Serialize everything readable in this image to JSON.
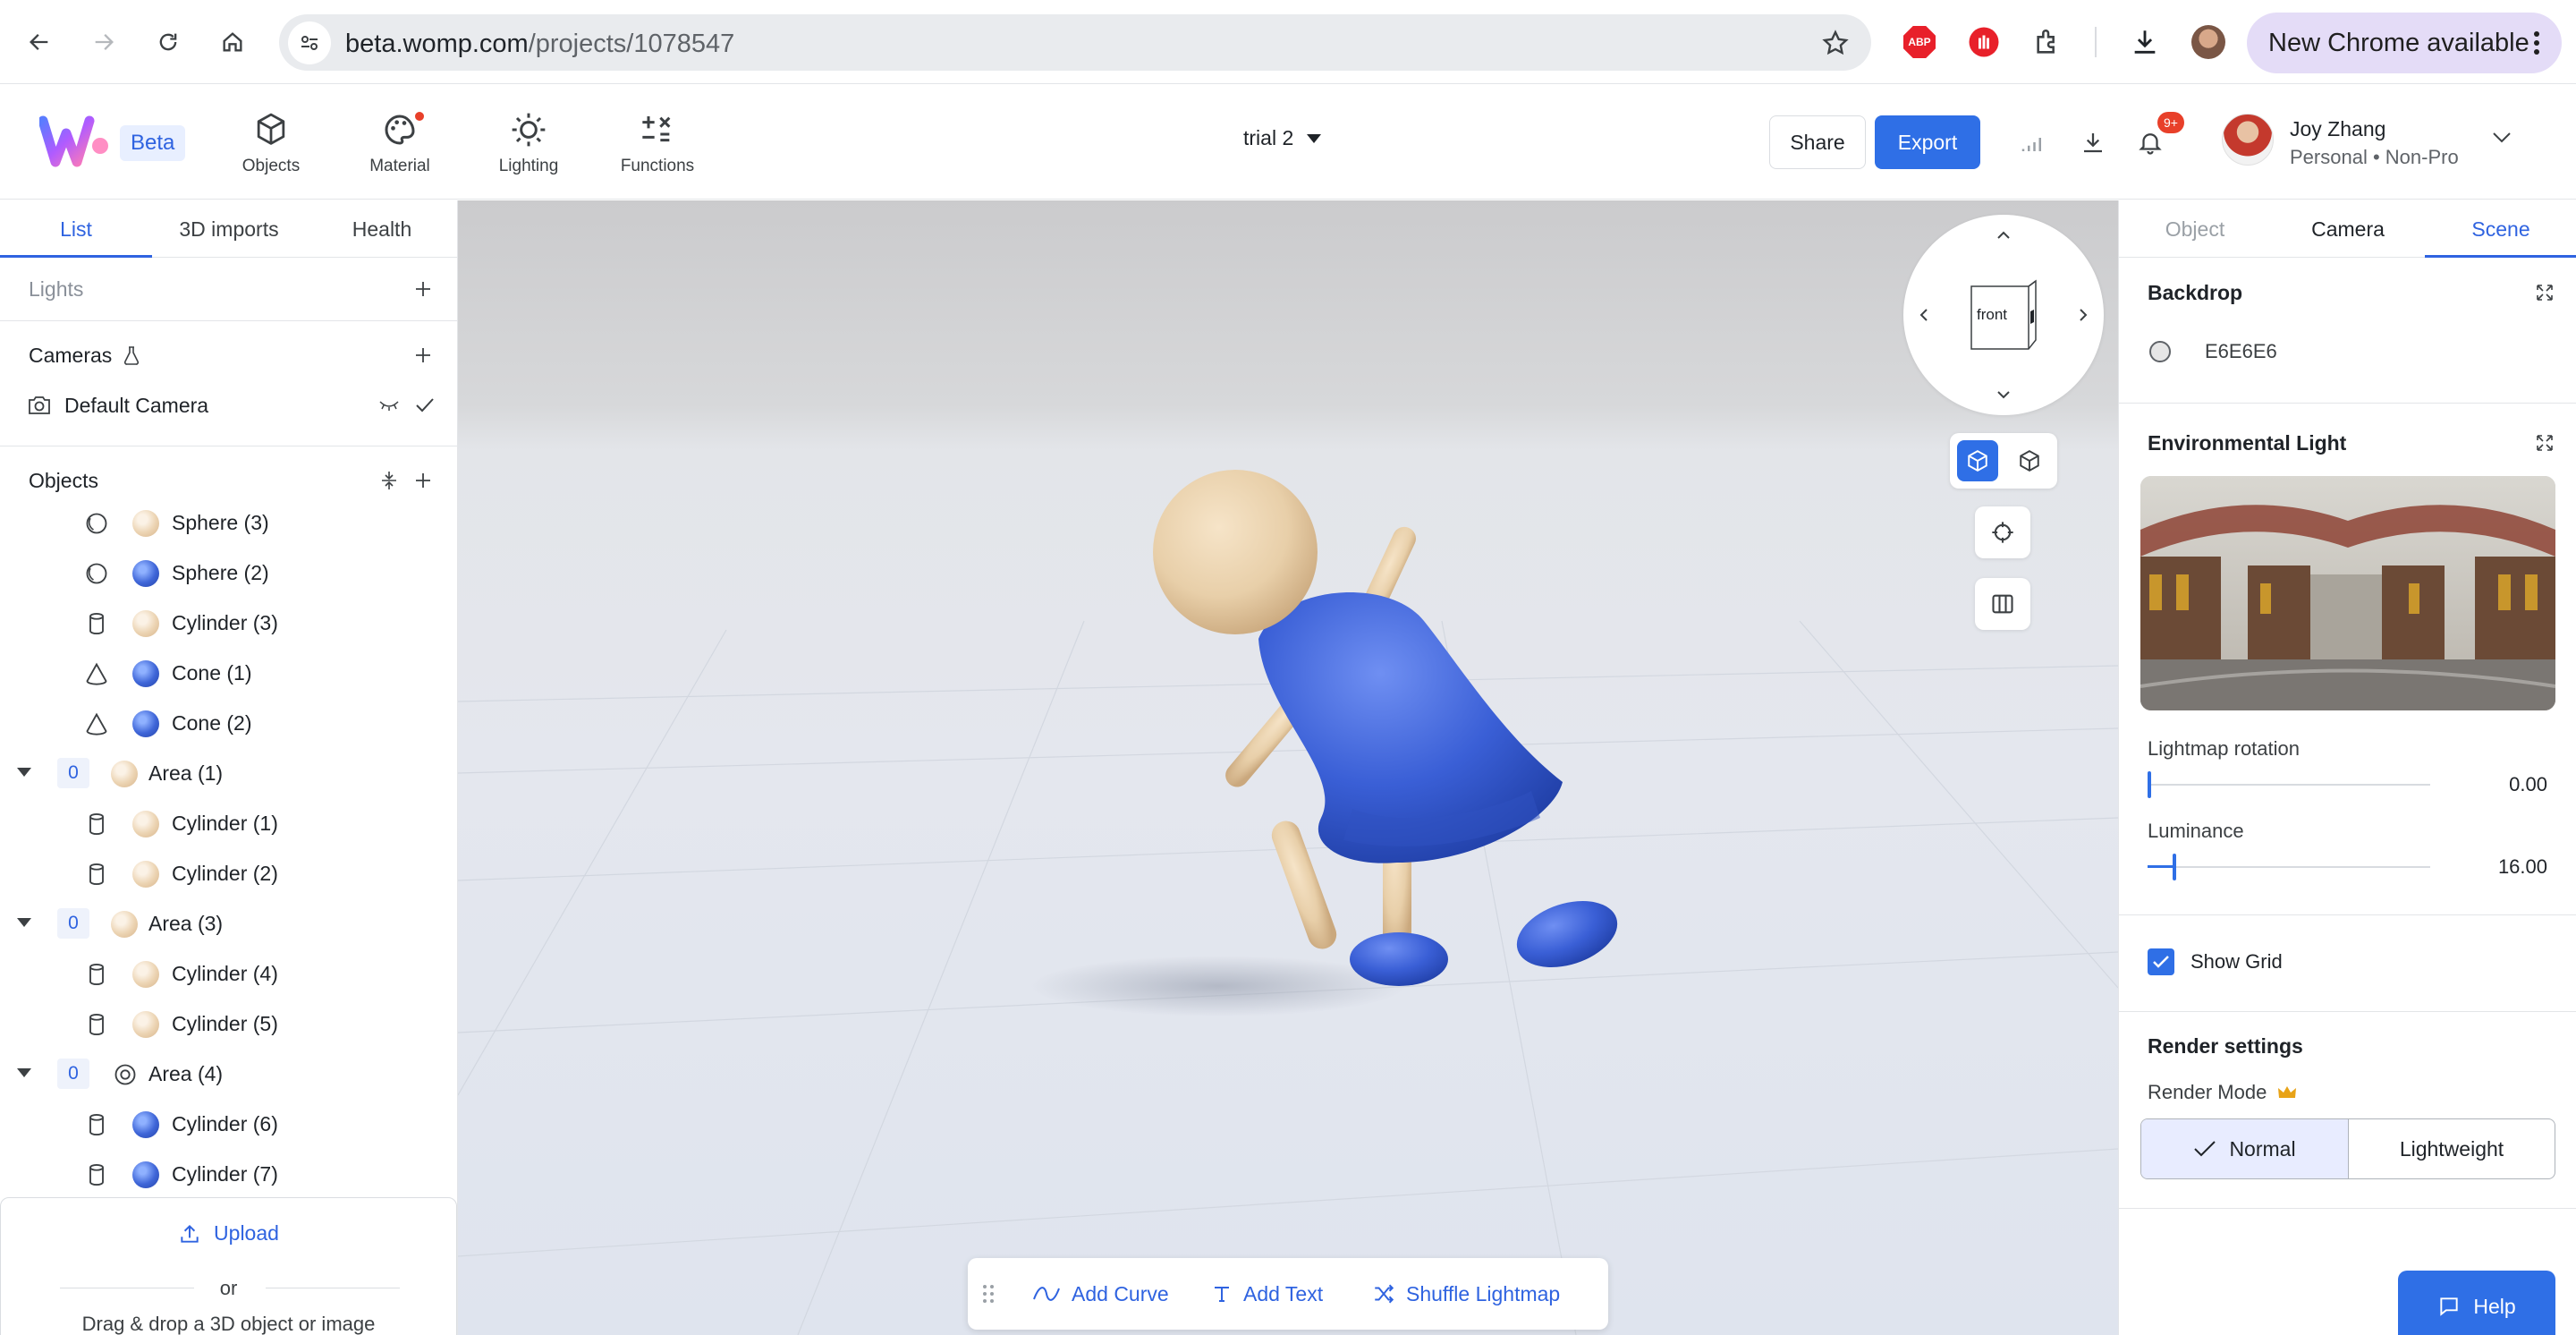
{
  "browser": {
    "url_host": "beta.womp.com",
    "url_path": "/projects/1078547",
    "abp_label": "ABP",
    "new_chrome_label": "New Chrome available"
  },
  "app": {
    "beta_badge": "Beta",
    "tools": [
      {
        "label": "Objects",
        "icon": "cube-icon"
      },
      {
        "label": "Material",
        "icon": "palette-icon"
      },
      {
        "label": "Lighting",
        "icon": "sun-icon"
      },
      {
        "label": "Functions",
        "icon": "math-ops-icon"
      }
    ],
    "project_title": "trial 2",
    "share_label": "Share",
    "export_label": "Export",
    "notification_badge": "9+",
    "user": {
      "name": "Joy Zhang",
      "plan": "Personal • Non-Pro"
    }
  },
  "left_panel": {
    "tabs": [
      {
        "label": "List",
        "active": true
      },
      {
        "label": "3D imports"
      },
      {
        "label": "Health"
      }
    ],
    "lights_title": "Lights",
    "cameras_title": "Cameras",
    "default_camera": "Default Camera",
    "objects_title": "Objects",
    "items": [
      {
        "indent": 1,
        "type": "sphere",
        "material": "cream",
        "name": "Sphere (3)"
      },
      {
        "indent": 1,
        "type": "sphere",
        "material": "blue",
        "name": "Sphere (2)"
      },
      {
        "indent": 1,
        "type": "cylinder",
        "material": "cream",
        "name": "Cylinder (3)"
      },
      {
        "indent": 1,
        "type": "cone",
        "material": "blue",
        "name": "Cone (1)"
      },
      {
        "indent": 1,
        "type": "cone",
        "material": "blue",
        "name": "Cone (2)"
      },
      {
        "indent": 0,
        "group": true,
        "count": "0",
        "type": "area",
        "material": "cream",
        "name": "Area (1)"
      },
      {
        "indent": 1,
        "type": "cylinder",
        "material": "cream",
        "name": "Cylinder (1)"
      },
      {
        "indent": 1,
        "type": "cylinder",
        "material": "cream",
        "name": "Cylinder (2)"
      },
      {
        "indent": 0,
        "group": true,
        "count": "0",
        "type": "area",
        "material": "cream",
        "name": "Area (3)"
      },
      {
        "indent": 1,
        "type": "cylinder",
        "material": "cream",
        "name": "Cylinder (4)"
      },
      {
        "indent": 1,
        "type": "cylinder",
        "material": "cream",
        "name": "Cylinder (5)"
      },
      {
        "indent": 0,
        "group": true,
        "count": "0",
        "type": "area-ring",
        "material": "none",
        "name": "Area (4)"
      },
      {
        "indent": 1,
        "type": "cylinder",
        "material": "blue",
        "name": "Cylinder (6)"
      },
      {
        "indent": 1,
        "type": "cylinder",
        "material": "blue",
        "name": "Cylinder (7)"
      }
    ],
    "upload_label": "Upload",
    "or_label": "or",
    "drag_label": "Drag & drop a 3D object or image"
  },
  "viewport": {
    "cube_face_label": "front",
    "toolbar": [
      {
        "label": "Add Curve",
        "icon": "curve-icon"
      },
      {
        "label": "Add Text",
        "icon": "text-icon"
      },
      {
        "label": "Shuffle Lightmap",
        "icon": "shuffle-icon"
      }
    ]
  },
  "right_panel": {
    "tabs": [
      {
        "label": "Object",
        "dim": true
      },
      {
        "label": "Camera"
      },
      {
        "label": "Scene",
        "active": true
      }
    ],
    "backdrop_title": "Backdrop",
    "backdrop_color": "E6E6E6",
    "env_title": "Environmental Light",
    "lightmap_rotation_label": "Lightmap rotation",
    "lightmap_rotation_value": "0.00",
    "lightmap_rotation_fraction": 0.0,
    "luminance_label": "Luminance",
    "luminance_value": "16.00",
    "luminance_fraction": 0.09,
    "show_grid_label": "Show Grid",
    "show_grid_checked": true,
    "render_settings_title": "Render settings",
    "render_mode_label": "Render Mode",
    "render_modes": [
      {
        "label": "Normal",
        "selected": true
      },
      {
        "label": "Lightweight"
      }
    ],
    "help_label": "Help"
  },
  "colors": {
    "accent": "#2f6fe6",
    "doll_blue": "#3a5fd6",
    "doll_wood": "#e8cfa9",
    "backdrop": "#E6E6E6"
  }
}
